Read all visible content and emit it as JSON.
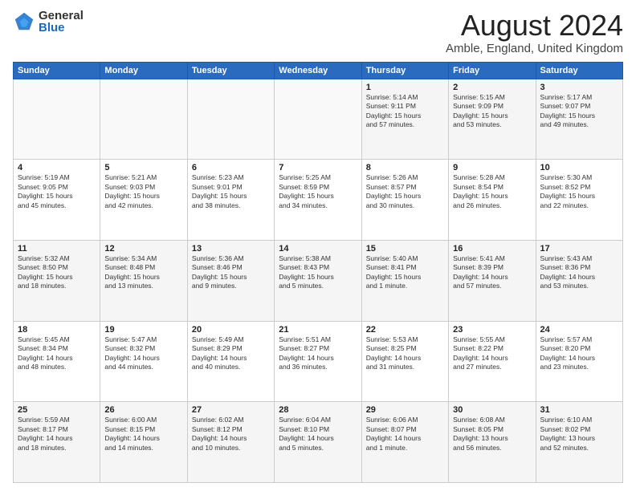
{
  "logo": {
    "general": "General",
    "blue": "Blue"
  },
  "header": {
    "month_year": "August 2024",
    "location": "Amble, England, United Kingdom"
  },
  "weekdays": [
    "Sunday",
    "Monday",
    "Tuesday",
    "Wednesday",
    "Thursday",
    "Friday",
    "Saturday"
  ],
  "weeks": [
    [
      {
        "day": "",
        "info": ""
      },
      {
        "day": "",
        "info": ""
      },
      {
        "day": "",
        "info": ""
      },
      {
        "day": "",
        "info": ""
      },
      {
        "day": "1",
        "info": "Sunrise: 5:14 AM\nSunset: 9:11 PM\nDaylight: 15 hours\nand 57 minutes."
      },
      {
        "day": "2",
        "info": "Sunrise: 5:15 AM\nSunset: 9:09 PM\nDaylight: 15 hours\nand 53 minutes."
      },
      {
        "day": "3",
        "info": "Sunrise: 5:17 AM\nSunset: 9:07 PM\nDaylight: 15 hours\nand 49 minutes."
      }
    ],
    [
      {
        "day": "4",
        "info": "Sunrise: 5:19 AM\nSunset: 9:05 PM\nDaylight: 15 hours\nand 45 minutes."
      },
      {
        "day": "5",
        "info": "Sunrise: 5:21 AM\nSunset: 9:03 PM\nDaylight: 15 hours\nand 42 minutes."
      },
      {
        "day": "6",
        "info": "Sunrise: 5:23 AM\nSunset: 9:01 PM\nDaylight: 15 hours\nand 38 minutes."
      },
      {
        "day": "7",
        "info": "Sunrise: 5:25 AM\nSunset: 8:59 PM\nDaylight: 15 hours\nand 34 minutes."
      },
      {
        "day": "8",
        "info": "Sunrise: 5:26 AM\nSunset: 8:57 PM\nDaylight: 15 hours\nand 30 minutes."
      },
      {
        "day": "9",
        "info": "Sunrise: 5:28 AM\nSunset: 8:54 PM\nDaylight: 15 hours\nand 26 minutes."
      },
      {
        "day": "10",
        "info": "Sunrise: 5:30 AM\nSunset: 8:52 PM\nDaylight: 15 hours\nand 22 minutes."
      }
    ],
    [
      {
        "day": "11",
        "info": "Sunrise: 5:32 AM\nSunset: 8:50 PM\nDaylight: 15 hours\nand 18 minutes."
      },
      {
        "day": "12",
        "info": "Sunrise: 5:34 AM\nSunset: 8:48 PM\nDaylight: 15 hours\nand 13 minutes."
      },
      {
        "day": "13",
        "info": "Sunrise: 5:36 AM\nSunset: 8:46 PM\nDaylight: 15 hours\nand 9 minutes."
      },
      {
        "day": "14",
        "info": "Sunrise: 5:38 AM\nSunset: 8:43 PM\nDaylight: 15 hours\nand 5 minutes."
      },
      {
        "day": "15",
        "info": "Sunrise: 5:40 AM\nSunset: 8:41 PM\nDaylight: 15 hours\nand 1 minute."
      },
      {
        "day": "16",
        "info": "Sunrise: 5:41 AM\nSunset: 8:39 PM\nDaylight: 14 hours\nand 57 minutes."
      },
      {
        "day": "17",
        "info": "Sunrise: 5:43 AM\nSunset: 8:36 PM\nDaylight: 14 hours\nand 53 minutes."
      }
    ],
    [
      {
        "day": "18",
        "info": "Sunrise: 5:45 AM\nSunset: 8:34 PM\nDaylight: 14 hours\nand 48 minutes."
      },
      {
        "day": "19",
        "info": "Sunrise: 5:47 AM\nSunset: 8:32 PM\nDaylight: 14 hours\nand 44 minutes."
      },
      {
        "day": "20",
        "info": "Sunrise: 5:49 AM\nSunset: 8:29 PM\nDaylight: 14 hours\nand 40 minutes."
      },
      {
        "day": "21",
        "info": "Sunrise: 5:51 AM\nSunset: 8:27 PM\nDaylight: 14 hours\nand 36 minutes."
      },
      {
        "day": "22",
        "info": "Sunrise: 5:53 AM\nSunset: 8:25 PM\nDaylight: 14 hours\nand 31 minutes."
      },
      {
        "day": "23",
        "info": "Sunrise: 5:55 AM\nSunset: 8:22 PM\nDaylight: 14 hours\nand 27 minutes."
      },
      {
        "day": "24",
        "info": "Sunrise: 5:57 AM\nSunset: 8:20 PM\nDaylight: 14 hours\nand 23 minutes."
      }
    ],
    [
      {
        "day": "25",
        "info": "Sunrise: 5:59 AM\nSunset: 8:17 PM\nDaylight: 14 hours\nand 18 minutes."
      },
      {
        "day": "26",
        "info": "Sunrise: 6:00 AM\nSunset: 8:15 PM\nDaylight: 14 hours\nand 14 minutes."
      },
      {
        "day": "27",
        "info": "Sunrise: 6:02 AM\nSunset: 8:12 PM\nDaylight: 14 hours\nand 10 minutes."
      },
      {
        "day": "28",
        "info": "Sunrise: 6:04 AM\nSunset: 8:10 PM\nDaylight: 14 hours\nand 5 minutes."
      },
      {
        "day": "29",
        "info": "Sunrise: 6:06 AM\nSunset: 8:07 PM\nDaylight: 14 hours\nand 1 minute."
      },
      {
        "day": "30",
        "info": "Sunrise: 6:08 AM\nSunset: 8:05 PM\nDaylight: 13 hours\nand 56 minutes."
      },
      {
        "day": "31",
        "info": "Sunrise: 6:10 AM\nSunset: 8:02 PM\nDaylight: 13 hours\nand 52 minutes."
      }
    ]
  ]
}
